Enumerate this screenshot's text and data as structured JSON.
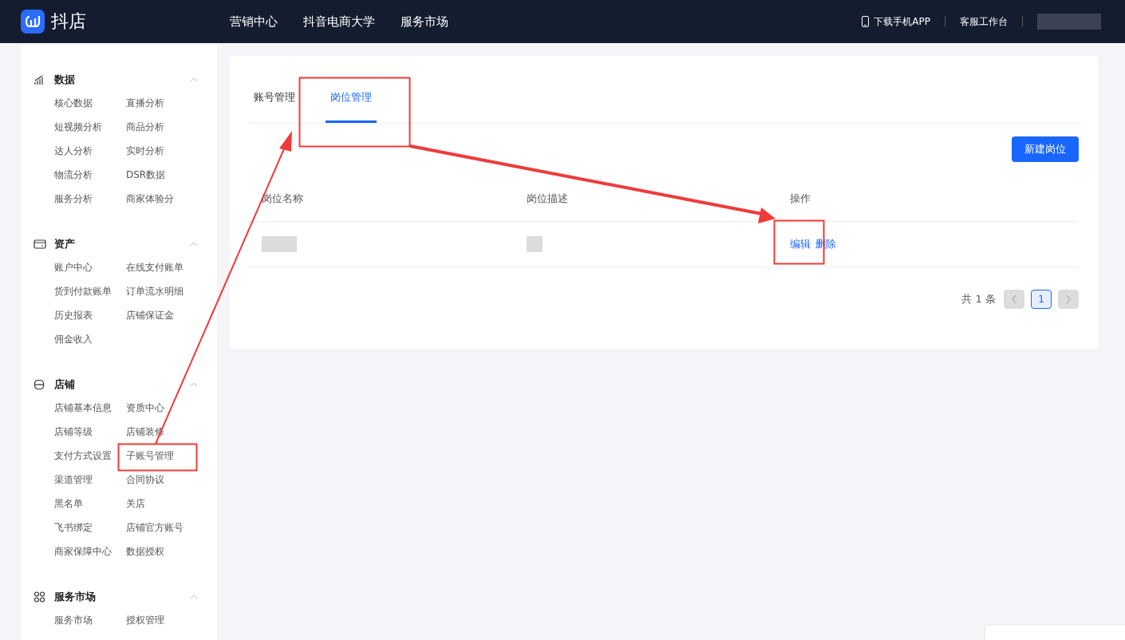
{
  "header": {
    "logo": "抖店",
    "nav": [
      {
        "label": "营销中心"
      },
      {
        "label": "抖音电商大学"
      },
      {
        "label": "服务市场"
      }
    ],
    "download_app": "下载手机APP",
    "service_desk": "客服工作台"
  },
  "sidebar": {
    "sections": [
      {
        "title": "数据",
        "kind": "chart",
        "expanded": true,
        "items": [
          {
            "label": "核心数据",
            "selected": false
          },
          {
            "label": "直播分析",
            "selected": false
          },
          {
            "label": "短视频分析",
            "selected": false
          },
          {
            "label": "商品分析",
            "selected": false
          },
          {
            "label": "达人分析",
            "selected": false
          },
          {
            "label": "实时分析",
            "selected": false
          },
          {
            "label": "物流分析",
            "selected": false
          },
          {
            "label": "DSR数据",
            "selected": false
          },
          {
            "label": "服务分析",
            "selected": false
          },
          {
            "label": "商家体验分",
            "selected": false
          }
        ]
      },
      {
        "title": "资产",
        "kind": "wallet",
        "expanded": true,
        "items": [
          {
            "label": "账户中心",
            "selected": false
          },
          {
            "label": "在线支付账单",
            "selected": false
          },
          {
            "label": "货到付款账单",
            "selected": false
          },
          {
            "label": "订单流水明细",
            "selected": false
          },
          {
            "label": "历史报表",
            "selected": false
          },
          {
            "label": "店铺保证金",
            "selected": false
          },
          {
            "label": "佣金收入",
            "selected": false
          }
        ]
      },
      {
        "title": "店铺",
        "kind": "store",
        "expanded": true,
        "items": [
          {
            "label": "店铺基本信息",
            "selected": false
          },
          {
            "label": "资质中心",
            "selected": false
          },
          {
            "label": "店铺等级",
            "selected": false
          },
          {
            "label": "店铺装修",
            "selected": false
          },
          {
            "label": "支付方式设置",
            "selected": false
          },
          {
            "label": "子账号管理",
            "selected": false
          },
          {
            "label": "渠道管理",
            "selected": false
          },
          {
            "label": "合同协议",
            "selected": false
          },
          {
            "label": "黑名单",
            "selected": false
          },
          {
            "label": "关店",
            "selected": false
          },
          {
            "label": "飞书绑定",
            "selected": false
          },
          {
            "label": "店铺官方账号",
            "selected": false
          },
          {
            "label": "商家保障中心",
            "selected": false
          },
          {
            "label": "数据授权",
            "selected": false
          }
        ]
      },
      {
        "title": "服务市场",
        "kind": "grid",
        "expanded": true,
        "items": [
          {
            "label": "服务市场",
            "selected": false
          },
          {
            "label": "授权管理",
            "selected": false
          }
        ]
      }
    ]
  },
  "tabs": [
    {
      "label": "账号管理",
      "selected": false
    },
    {
      "label": "岗位管理",
      "selected": true
    }
  ],
  "new_button": "新建岗位",
  "table": {
    "columns": [
      "岗位名称",
      "岗位描述",
      "操作"
    ],
    "rows": [
      {
        "actions": [
          "编辑",
          "删除"
        ]
      }
    ]
  },
  "pagination": {
    "total": "共 1 条",
    "prev_disabled": true,
    "next_disabled": true,
    "pages": [
      {
        "label": "1",
        "selected": true
      }
    ]
  }
}
